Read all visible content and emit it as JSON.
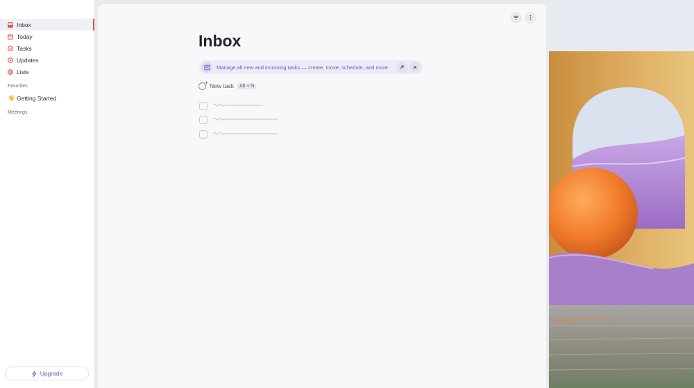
{
  "sidebar": {
    "items": [
      {
        "label": "Inbox",
        "icon": "inbox-icon",
        "active": true,
        "color": "#e8524c"
      },
      {
        "label": "Today",
        "icon": "calendar-icon",
        "active": false,
        "color": "#e8524c"
      },
      {
        "label": "Tasks",
        "icon": "tasks-icon",
        "active": false,
        "color": "#e8524c"
      },
      {
        "label": "Updates",
        "icon": "updates-icon",
        "active": false,
        "color": "#e8524c"
      },
      {
        "label": "Lists",
        "icon": "lists-icon",
        "active": false,
        "color": "#e8524c"
      }
    ],
    "favorites_label": "Favorites",
    "favorites": [
      {
        "label": "Getting Started",
        "icon": "waving-hand-icon"
      }
    ],
    "meetings_label": "Meetings",
    "upgrade_label": "Upgrade"
  },
  "main": {
    "title": "Inbox",
    "banner_text": "Manage all new and incoming tasks — create, move, schedule, and more",
    "new_task_label": "New task",
    "new_task_shortcut": "Alt + N"
  },
  "colors": {
    "accent": "#5a5fc4",
    "brand_red": "#e8524c"
  }
}
